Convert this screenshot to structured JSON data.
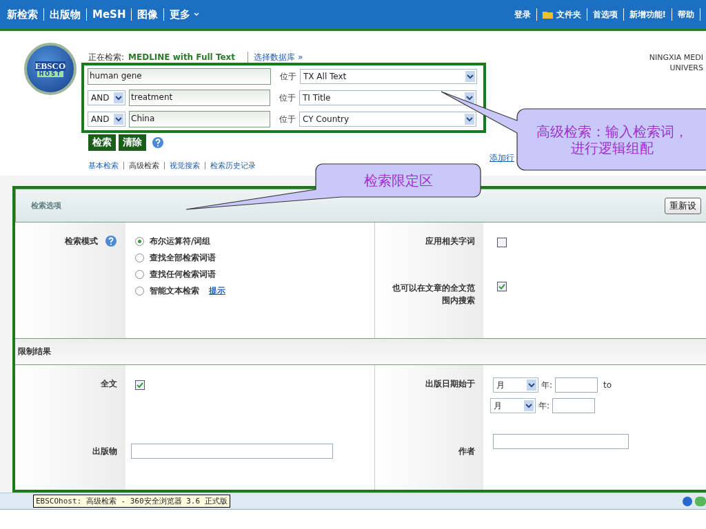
{
  "nav": {
    "left": [
      {
        "label": "新检索",
        "kind": "text"
      },
      {
        "label": "出版物",
        "kind": "text"
      },
      {
        "label": "MeSH",
        "kind": "text"
      },
      {
        "label": "图像",
        "kind": "text"
      },
      {
        "label": "更多",
        "kind": "menu"
      }
    ],
    "right": [
      {
        "label": "登录",
        "kind": "text"
      },
      {
        "label": "文件夹",
        "kind": "folder"
      },
      {
        "label": "首选项",
        "kind": "text"
      },
      {
        "label": "新增功能!",
        "kind": "text"
      },
      {
        "label": "帮助",
        "kind": "text"
      }
    ]
  },
  "logo": {
    "line1": "EBSCO",
    "line2": "HOST"
  },
  "database": {
    "prefix": "正在检索:",
    "name": "MEDLINE with Full Text",
    "link": "选择数据库 »"
  },
  "institution": [
    "NINGXIA MEDI",
    "UNIVERS"
  ],
  "search_rows": [
    {
      "value": "human gene",
      "field_prefix": "位于",
      "field": "TX All Text"
    },
    {
      "operator": "AND",
      "value": "treatment",
      "field_prefix": "位于",
      "field": "TI Title"
    },
    {
      "operator": "AND",
      "value": "China",
      "field_prefix": "位于",
      "field": "CY Country"
    }
  ],
  "add_row_link": "添加行",
  "buttons": [
    "检索",
    "清除"
  ],
  "search_links": [
    {
      "label": "基本检索",
      "selected": false
    },
    {
      "label": "高级检索",
      "selected": true
    },
    {
      "label": "视觉搜索",
      "selected": false
    },
    {
      "label": "检索历史记录",
      "selected": false
    }
  ],
  "options": {
    "title": "检索选项",
    "reset_button": "重新设",
    "mode_label": "检索模式",
    "modes": [
      {
        "label": "布尔运算符/词组",
        "selected": true
      },
      {
        "label": "查找全部检索词语",
        "selected": false
      },
      {
        "label": "查找任何检索词语",
        "selected": false
      },
      {
        "label": "智能文本检索",
        "selected": false,
        "link": "提示"
      }
    ],
    "checks": [
      {
        "label": "应用相关字词",
        "checked": false
      },
      {
        "label": "也可以在文章的全文范围内搜索",
        "checked": true
      }
    ]
  },
  "limits": {
    "title": "限制结果",
    "full_text": {
      "label": "全文",
      "checked": true
    },
    "date": {
      "label": "出版日期始于",
      "from_month": "月",
      "from_year_label": "年:",
      "to": "to",
      "to_month": "月",
      "to_year_label": "年:"
    },
    "publication": {
      "label": "出版物"
    },
    "author": {
      "label": "作者"
    }
  },
  "status_bar": {
    "text": "EBSCOhost: 高级检索 - 360安全浏览器 3.6 正式版"
  },
  "callouts": [
    {
      "text": "检索限定区"
    },
    {
      "text": "高级检索：输入检索词，进行逻辑组配"
    }
  ]
}
